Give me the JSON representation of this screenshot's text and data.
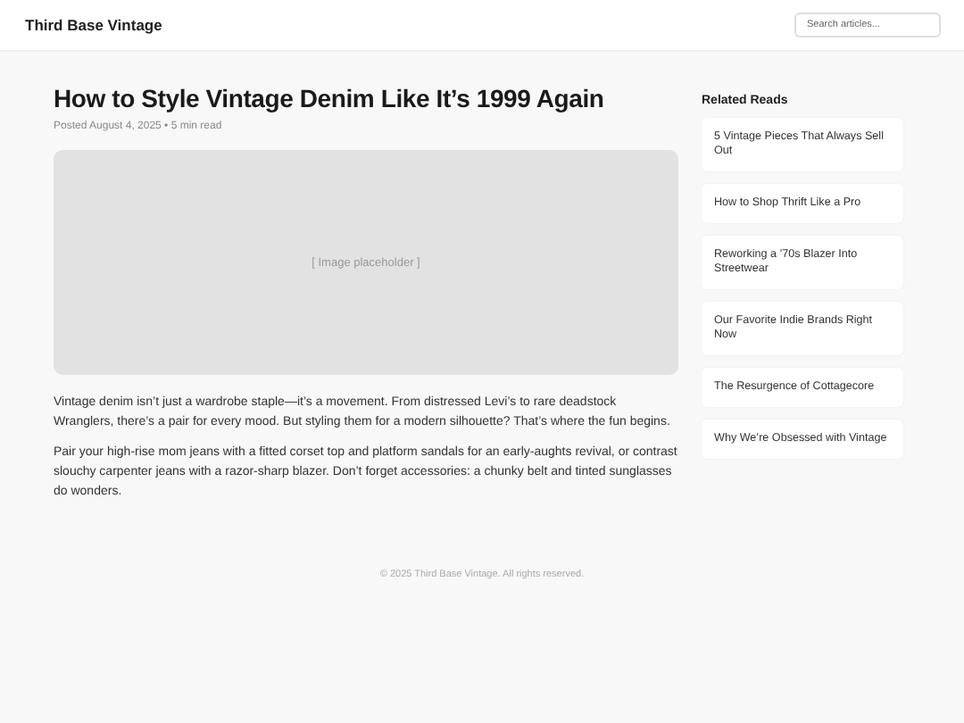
{
  "header": {
    "brand": "Third Base Vintage",
    "search": {
      "placeholder": "Search articles..."
    }
  },
  "article": {
    "title": "How to Style Vintage Denim Like It’s 1999 Again",
    "meta": "Posted August 4, 2025 • 5 min read",
    "image": {
      "label": "[ Image placeholder ]"
    },
    "paragraphs": [
      "Vintage denim isn’t just a wardrobe staple—it’s a movement. From distressed Levi’s to rare deadstock Wranglers, there’s a pair for every mood. But styling them for a modern silhouette? That’s where the fun begins.",
      "Pair your high-rise mom jeans with a fitted corset top and platform sandals for an early-aughts revival, or contrast slouchy carpenter jeans with a razor-sharp blazer. Don’t forget accessories: a chunky belt and tinted sunglasses do wonders."
    ]
  },
  "sidebar": {
    "title": "Related Reads",
    "items": [
      "5 Vintage Pieces That Always Sell Out",
      "How to Shop Thrift Like a Pro",
      "Reworking a ’70s Blazer Into Streetwear",
      "Our Favorite Indie Brands Right Now",
      "The Resurgence of Cottagecore",
      "Why We’re Obsessed with Vintage"
    ]
  },
  "footer": "© 2025 Third Base Vintage. All rights reserved."
}
